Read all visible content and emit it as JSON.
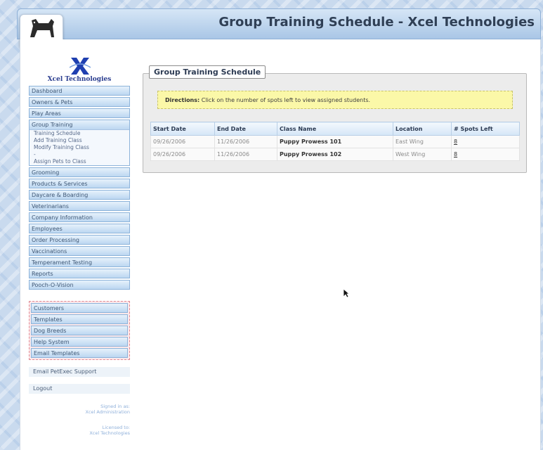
{
  "header": {
    "title": "Group Training Schedule - Xcel Technologies",
    "logo_text": "pet"
  },
  "brand": {
    "name": "Xcel Technologies"
  },
  "sidebar": {
    "items": [
      {
        "label": "Dashboard"
      },
      {
        "label": "Owners & Pets"
      },
      {
        "label": "Play Areas"
      }
    ],
    "group": {
      "label": "Group Training",
      "sub_items": [
        "Training Schedule",
        "Add Training Class",
        "Modify Training Class",
        "-",
        "Assign Pets to Class"
      ]
    },
    "items_after": [
      {
        "label": "Grooming"
      },
      {
        "label": "Products & Services"
      },
      {
        "label": "Daycare & Boarding"
      },
      {
        "label": "Veterinarians"
      },
      {
        "label": "Company Information"
      },
      {
        "label": "Employees"
      },
      {
        "label": "Order Processing"
      },
      {
        "label": "Vaccinations"
      },
      {
        "label": "Temperament Testing"
      },
      {
        "label": "Reports"
      },
      {
        "label": "Pooch-O-Vision"
      }
    ],
    "admin_items": [
      {
        "label": "Customers"
      },
      {
        "label": "Templates"
      },
      {
        "label": "Dog Breeds"
      },
      {
        "label": "Help System"
      },
      {
        "label": "Email Templates"
      }
    ],
    "support_link": "Email PetExec Support",
    "logout_link": "Logout",
    "signed_in_line1": "Signed in as:",
    "signed_in_line2": "Xcel Administration",
    "licensed_line1": "Licensed to:",
    "licensed_line2": "Xcel Technologies"
  },
  "main": {
    "panel_title": "Group Training Schedule",
    "directions_label": "Directions:",
    "directions_text": "Click on the number of spots left to view assigned students.",
    "columns": [
      "Start Date",
      "End Date",
      "Class Name",
      "Location",
      "# Spots Left"
    ],
    "rows": [
      {
        "start": "09/26/2006",
        "end": "11/26/2006",
        "class": "Puppy Prowess 101",
        "location": "East Wing",
        "spots": "8"
      },
      {
        "start": "09/26/2006",
        "end": "11/26/2006",
        "class": "Puppy Prowess 102",
        "location": "West Wing",
        "spots": "8"
      }
    ]
  }
}
